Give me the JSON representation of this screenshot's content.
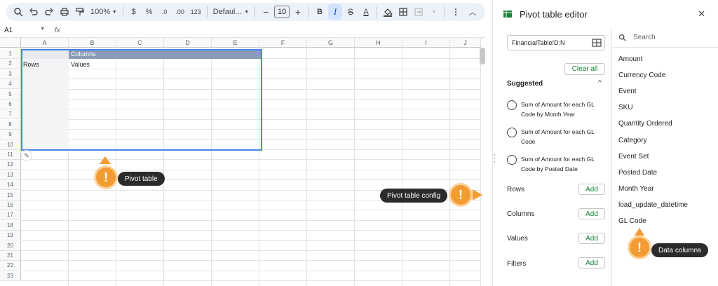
{
  "toolbar": {
    "zoom": "100%",
    "currency": "$",
    "percent": "%",
    "dec_less": ".0",
    "dec_more": ".00",
    "number_format": "123",
    "font": "Defaul...",
    "font_size": "10",
    "bold": "B",
    "italic": "I",
    "text_color": "A"
  },
  "formula_bar": {
    "cell_ref": "A1",
    "fx": "fx"
  },
  "grid": {
    "columns": [
      "A",
      "B",
      "C",
      "D",
      "E",
      "F",
      "G",
      "H",
      "I",
      "J"
    ],
    "rows": [
      "1",
      "2",
      "3",
      "4",
      "5",
      "6",
      "7",
      "8",
      "9",
      "10",
      "11",
      "12",
      "13",
      "14",
      "15",
      "16",
      "17",
      "18",
      "19",
      "20",
      "21",
      "22",
      "23"
    ],
    "pivot_columns_label": "Columns",
    "pivot_rows_label": "Rows",
    "pivot_values_label": "Values"
  },
  "callouts": {
    "pivot_table": "Pivot table",
    "pivot_config": "Pivot table config",
    "data_columns": "Data columns"
  },
  "panel": {
    "title": "Pivot table editor",
    "range": "FinancialTable!D:N",
    "clear_all": "Clear all",
    "suggested": "Suggested",
    "suggestions": [
      "Sum of Amount for each GL Code by Month Year",
      "Sum of Amount for each GL Code",
      "Sum of Amount for each GL Code by Posted Date"
    ],
    "sections": {
      "rows": "Rows",
      "columns": "Columns",
      "values": "Values",
      "filters": "Filters"
    },
    "add_label": "Add",
    "search_placeholder": "Search",
    "fields": [
      "Amount",
      "Currency Code",
      "Event",
      "SKU",
      "Quantity Ordered",
      "Category",
      "Event Set",
      "Posted Date",
      "Month Year",
      "load_update_datetime",
      "GL Code"
    ]
  },
  "colors": {
    "accent_green": "#188038",
    "callout_orange": "#f39c34",
    "pivot_header": "#8a9ab8",
    "selection_blue": "#4a86e8"
  }
}
